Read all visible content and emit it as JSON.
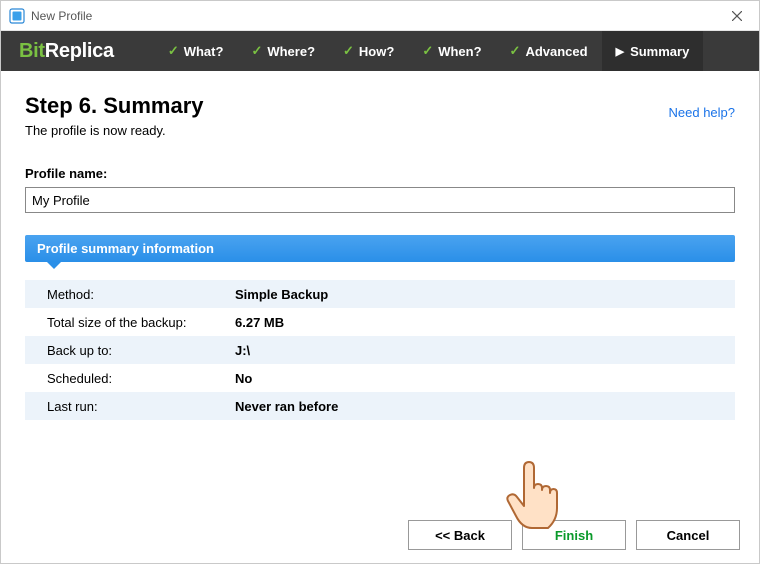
{
  "window": {
    "title": "New Profile"
  },
  "brand": {
    "prefix": "Bit",
    "suffix": "Replica"
  },
  "nav": {
    "steps": [
      {
        "label": "What?",
        "done": true,
        "active": false
      },
      {
        "label": "Where?",
        "done": true,
        "active": false
      },
      {
        "label": "How?",
        "done": true,
        "active": false
      },
      {
        "label": "When?",
        "done": true,
        "active": false
      },
      {
        "label": "Advanced",
        "done": true,
        "active": false
      },
      {
        "label": "Summary",
        "done": false,
        "active": true
      }
    ]
  },
  "page": {
    "heading": "Step 6. Summary",
    "subheading": "The profile is now ready.",
    "help_link": "Need help?"
  },
  "profile_name": {
    "label": "Profile name:",
    "value": "My Profile"
  },
  "section": {
    "title": "Profile summary information"
  },
  "summary": [
    {
      "key": "Method:",
      "val": "Simple Backup"
    },
    {
      "key": "Total size of the backup:",
      "val": "6.27 MB"
    },
    {
      "key": "Back up to:",
      "val": "J:\\"
    },
    {
      "key": "Scheduled:",
      "val": "No"
    },
    {
      "key": "Last run:",
      "val": "Never ran before"
    }
  ],
  "buttons": {
    "back": "<< Back",
    "finish": "Finish",
    "cancel": "Cancel"
  }
}
